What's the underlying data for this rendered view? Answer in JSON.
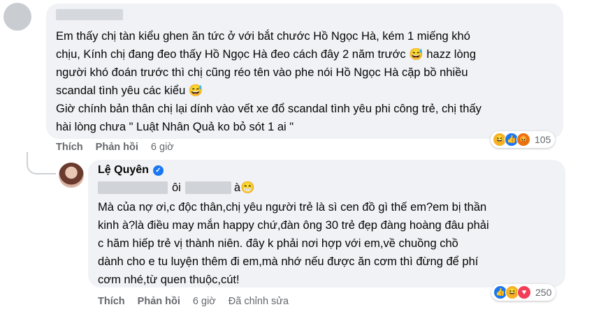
{
  "comment1": {
    "text": "Em thấy chị tàn kiểu ghen ăn tức ở với bắt chước Hồ Ngọc Hà, kém 1 miếng khó\nchịu, Kính chị đang đeo thấy Hồ Ngọc Hà đeo cách đây 2 năm trước 😅 hazz lòng\nngười khó đoán trước thì chị cũng réo tên vào phe nói Hồ Ngọc Hà cặp bồ nhiều\nscandal tình yêu các kiểu 😅\nGiờ chính bản thân chị lại dính vào vết xe đổ scandal tình yêu phi công trẻ, chị thấy\nhài lòng chưa \" Luật Nhân Quả ko bỏ sót 1 ai \"",
    "like_label": "Thích",
    "reply_label": "Phản hồi",
    "time": "6 giờ",
    "reaction_count": "105",
    "reaction_icons": [
      "haha-icon",
      "like-icon",
      "angry-icon"
    ]
  },
  "reply": {
    "author": "Lệ Quyên",
    "line1_middle": "ôi",
    "line1_end": "à😁",
    "text": "Mà của nợ ơi,c độc thân,chị yêu người trẻ là sì cen đồ gì thế em?em bị thần\nkinh à?là điều may mắn happy chứ,đàn ông 30 trẻ đẹp đàng hoàng đâu phải\nc hăm hiếp trẻ vị thành niên.   đây k phải nơi hợp với em,về chuồng chồ\ndành cho e tu luyện thêm đi em,mà nhớ nếu được ăn cơm thì đừng để phí\ncơm nhé,từ quen thuộc,cút!",
    "like_label": "Thích",
    "reply_label": "Phản hồi",
    "time": "6 giờ",
    "edited": "Đã chỉnh sửa",
    "reaction_count": "250",
    "reaction_icons": [
      "like-icon",
      "haha-icon",
      "love-icon"
    ]
  }
}
